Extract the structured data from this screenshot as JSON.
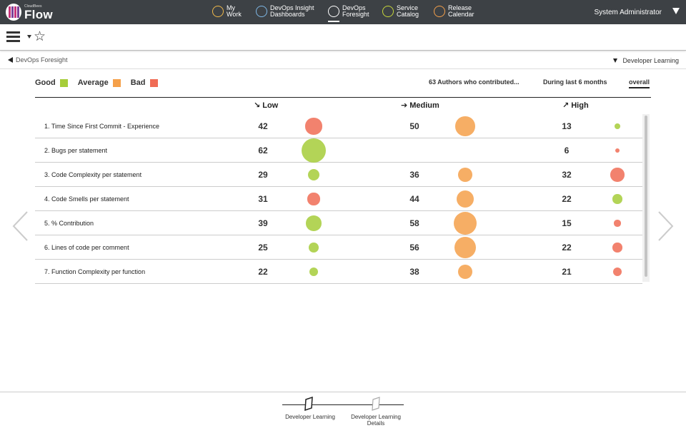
{
  "app": {
    "brand_small": "CloudBees",
    "brand": "Flow",
    "user": "System Administrator"
  },
  "nav": [
    {
      "line1": "My",
      "line2": "Work",
      "icon": "my-work-icon"
    },
    {
      "line1": "DevOps Insight",
      "line2": "Dashboards",
      "icon": "insight-icon"
    },
    {
      "line1": "DevOps",
      "line2": "Foresight",
      "icon": "foresight-icon",
      "active": true
    },
    {
      "line1": "Service",
      "line2": "Catalog",
      "icon": "catalog-icon"
    },
    {
      "line1": "Release",
      "line2": "Calendar",
      "icon": "calendar-icon"
    }
  ],
  "breadcrumb": {
    "back_label": "DevOps Foresight",
    "context_label": "Developer Learning"
  },
  "legend": [
    {
      "label": "Good",
      "color": "#a6cd3a"
    },
    {
      "label": "Average",
      "color": "#f5a04a"
    },
    {
      "label": "Bad",
      "color": "#f06c55"
    }
  ],
  "filters": {
    "authors": "63 Authors who contributed...",
    "period": "During last 6 months",
    "scope": "overall"
  },
  "columns": [
    {
      "label": "Low",
      "arrow": "↘"
    },
    {
      "label": "Medium",
      "arrow": "➔"
    },
    {
      "label": "High",
      "arrow": "↗"
    }
  ],
  "rows": [
    {
      "label": "1.  Time Since First Commit - Experience",
      "low": "42",
      "medium": "50",
      "high": "13",
      "low_color": "#f06c55",
      "medium_color": "#f5a04a",
      "high_color": "#a6cd3a"
    },
    {
      "label": "2.  Bugs per statement",
      "low": "62",
      "medium": "",
      "high": "6",
      "low_color": "#a6cd3a",
      "medium_color": "#f5a04a",
      "high_color": "#f06c55"
    },
    {
      "label": "3.  Code Complexity per statement",
      "low": "29",
      "medium": "36",
      "high": "32",
      "low_color": "#a6cd3a",
      "medium_color": "#f5a04a",
      "high_color": "#f06c55"
    },
    {
      "label": "4.  Code Smells per statement",
      "low": "31",
      "medium": "44",
      "high": "22",
      "low_color": "#f06c55",
      "medium_color": "#f5a04a",
      "high_color": "#a6cd3a"
    },
    {
      "label": "5.  % Contribution",
      "low": "39",
      "medium": "58",
      "high": "15",
      "low_color": "#a6cd3a",
      "medium_color": "#f5a04a",
      "high_color": "#f06c55"
    },
    {
      "label": "6.  Lines of code per comment",
      "low": "25",
      "medium": "56",
      "high": "22",
      "low_color": "#a6cd3a",
      "medium_color": "#f5a04a",
      "high_color": "#f06c55"
    },
    {
      "label": "7.  Function Complexity per function",
      "low": "22",
      "medium": "38",
      "high": "21",
      "low_color": "#a6cd3a",
      "medium_color": "#f5a04a",
      "high_color": "#f06c55"
    }
  ],
  "pager": {
    "step1": "Developer Learning",
    "step2_line1": "Developer Learning",
    "step2_line2": "Details"
  }
}
